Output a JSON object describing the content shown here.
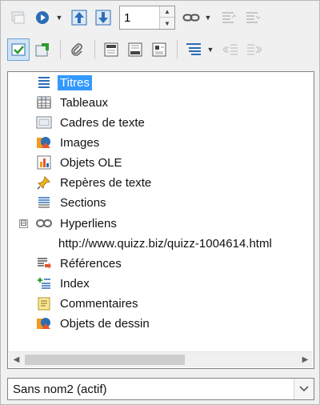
{
  "toolbar": {
    "page_number": "1",
    "buttons": [
      {
        "icon": "toggle-icon"
      },
      {
        "icon": "navigation-icon"
      },
      {
        "icon": "previous-icon"
      },
      {
        "icon": "next-icon"
      },
      {
        "icon": "drag-mode-icon"
      },
      {
        "icon": "content-view-icon"
      },
      {
        "icon": "set-reminder-icon"
      },
      {
        "icon": "header-icon"
      },
      {
        "icon": "footer-icon"
      },
      {
        "icon": "anchor-icon"
      },
      {
        "icon": "heading-levels-icon"
      },
      {
        "icon": "promote-chapter-icon"
      },
      {
        "icon": "demote-chapter-icon"
      },
      {
        "icon": "promote-level-icon"
      },
      {
        "icon": "demote-level-icon"
      }
    ]
  },
  "tree": {
    "items": [
      {
        "label": "Titres",
        "icon": "headings-icon",
        "selected": true
      },
      {
        "label": "Tableaux",
        "icon": "table-icon"
      },
      {
        "label": "Cadres de texte",
        "icon": "text-frame-icon"
      },
      {
        "label": "Images",
        "icon": "image-icon"
      },
      {
        "label": "Objets OLE",
        "icon": "ole-object-icon"
      },
      {
        "label": "Repères de texte",
        "icon": "bookmark-icon"
      },
      {
        "label": "Sections",
        "icon": "sections-icon"
      },
      {
        "label": "Hyperliens",
        "icon": "hyperlink-icon",
        "expanded": true,
        "expander": "⊟"
      },
      {
        "label": "http://www.quizz.biz/quizz-1004614.html",
        "child": true
      },
      {
        "label": "Références",
        "icon": "references-icon"
      },
      {
        "label": "Index",
        "icon": "index-icon"
      },
      {
        "label": "Commentaires",
        "icon": "comment-icon"
      },
      {
        "label": "Objets de dessin",
        "icon": "drawing-object-icon"
      }
    ]
  },
  "document_select": {
    "value": "Sans nom2 (actif)"
  },
  "colors": {
    "selection": "#3399ff",
    "accent_blue": "#2d6db5",
    "orange": "#f29a1f"
  }
}
